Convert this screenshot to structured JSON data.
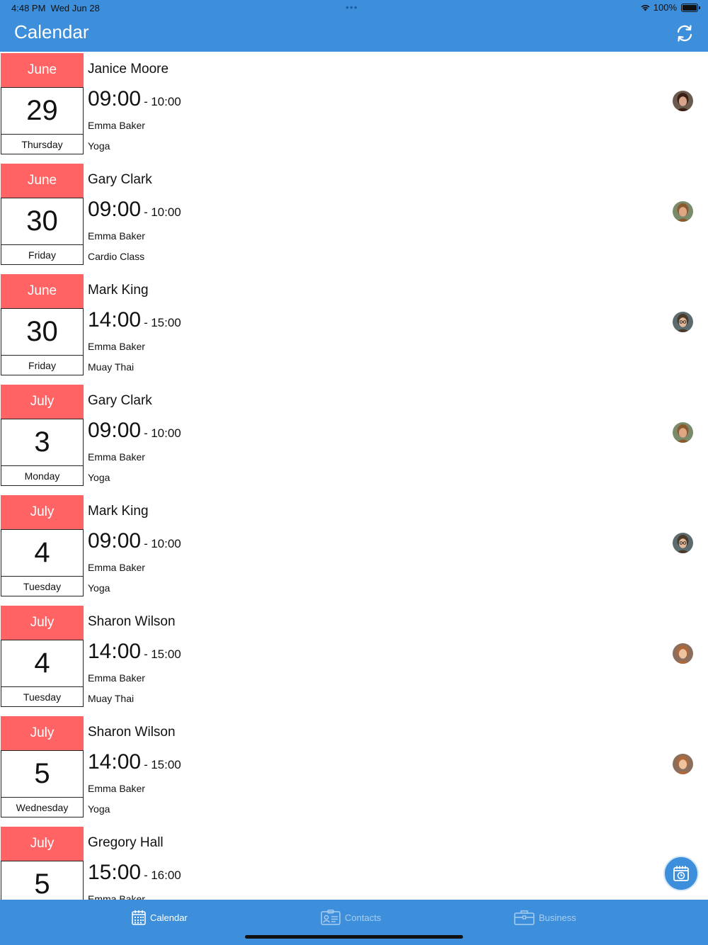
{
  "status_bar": {
    "time": "4:48 PM",
    "date": "Wed Jun 28",
    "dots": "•••",
    "battery": "100%"
  },
  "header": {
    "title": "Calendar"
  },
  "appointments": [
    {
      "month": "June",
      "day": "29",
      "weekday": "Thursday",
      "client": "Janice Moore",
      "start": "09:00",
      "sep": "-",
      "end": "10:00",
      "staff": "Emma Baker",
      "service": "Yoga",
      "avatar": "female-dark"
    },
    {
      "month": "June",
      "day": "30",
      "weekday": "Friday",
      "client": "Gary Clark",
      "start": "09:00",
      "sep": "-",
      "end": "10:00",
      "staff": "Emma Baker",
      "service": "Cardio Class",
      "avatar": "male-1"
    },
    {
      "month": "June",
      "day": "30",
      "weekday": "Friday",
      "client": "Mark King",
      "start": "14:00",
      "sep": "-",
      "end": "15:00",
      "staff": "Emma Baker",
      "service": "Muay Thai",
      "avatar": "male-glasses"
    },
    {
      "month": "July",
      "day": "3",
      "weekday": "Monday",
      "client": "Gary Clark",
      "start": "09:00",
      "sep": "-",
      "end": "10:00",
      "staff": "Emma Baker",
      "service": "Yoga",
      "avatar": "male-1"
    },
    {
      "month": "July",
      "day": "4",
      "weekday": "Tuesday",
      "client": "Mark King",
      "start": "09:00",
      "sep": "-",
      "end": "10:00",
      "staff": "Emma Baker",
      "service": "Yoga",
      "avatar": "male-glasses"
    },
    {
      "month": "July",
      "day": "4",
      "weekday": "Tuesday",
      "client": "Sharon Wilson",
      "start": "14:00",
      "sep": "-",
      "end": "15:00",
      "staff": "Emma Baker",
      "service": "Muay Thai",
      "avatar": "female-light"
    },
    {
      "month": "July",
      "day": "5",
      "weekday": "Wednesday",
      "client": "Sharon Wilson",
      "start": "14:00",
      "sep": "-",
      "end": "15:00",
      "staff": "Emma Baker",
      "service": "Yoga",
      "avatar": "female-light"
    },
    {
      "month": "July",
      "day": "5",
      "weekday": "",
      "client": "Gregory Hall",
      "start": "15:00",
      "sep": "-",
      "end": "16:00",
      "staff": "Emma Baker",
      "service": "",
      "avatar": ""
    }
  ],
  "tabs": [
    {
      "label": "Calendar",
      "icon": "calendar-icon",
      "active": true
    },
    {
      "label": "Contacts",
      "icon": "contact-card-icon",
      "active": false
    },
    {
      "label": "Business",
      "icon": "briefcase-icon",
      "active": false
    }
  ],
  "colors": {
    "primary": "#3d8fdb",
    "month_bg": "#ff6363",
    "tab_inactive": "#a9cdf0"
  }
}
